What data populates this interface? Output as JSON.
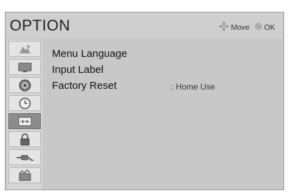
{
  "header": {
    "title": "OPTION",
    "hint_move": "Move",
    "hint_ok": "OK"
  },
  "sidebar": {
    "items": [
      {
        "icon": "picture-icon",
        "selected": false
      },
      {
        "icon": "screen-icon",
        "selected": false
      },
      {
        "icon": "audio-icon",
        "selected": false
      },
      {
        "icon": "clock-icon",
        "selected": false
      },
      {
        "icon": "option-icon",
        "selected": true
      },
      {
        "icon": "lock-icon",
        "selected": false
      },
      {
        "icon": "input-icon",
        "selected": false
      },
      {
        "icon": "media-icon",
        "selected": false
      }
    ]
  },
  "menu": {
    "items": [
      {
        "label": "Menu Language",
        "value": ""
      },
      {
        "label": "Input Label",
        "value": ""
      },
      {
        "label": "Factory Reset",
        "value": ": Home Use"
      }
    ]
  },
  "colors": {
    "panel_bg": "#c8c8c8",
    "selected_tab": "#8c8c8c"
  }
}
